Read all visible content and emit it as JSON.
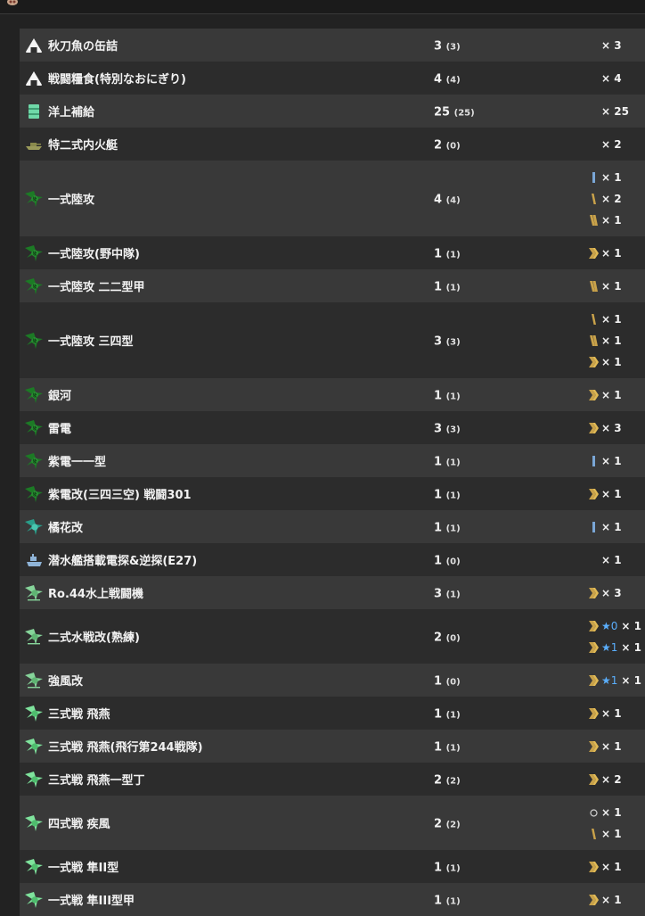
{
  "rows": [
    {
      "icon": "rice-ball-icon",
      "name": "秋刀魚の缶詰",
      "count": "3",
      "sub": "(3)",
      "h": 37,
      "rewards": [
        {
          "prefix": "none",
          "text": "× 3"
        }
      ]
    },
    {
      "icon": "rice-ball-icon",
      "name": "戦闘糧食(特別なおにぎり)",
      "count": "4",
      "sub": "(4)",
      "h": 37,
      "rewards": [
        {
          "prefix": "none",
          "text": "× 4"
        }
      ]
    },
    {
      "icon": "supply-crate-icon",
      "name": "洋上補給",
      "count": "25",
      "sub": "(25)",
      "h": 37,
      "rewards": [
        {
          "prefix": "none",
          "text": "× 25"
        }
      ]
    },
    {
      "icon": "boat-icon",
      "name": "特二式内火艇",
      "count": "2",
      "sub": "(0)",
      "h": 37,
      "rewards": [
        {
          "prefix": "none",
          "text": "× 2"
        }
      ]
    },
    {
      "icon": "land-bomber-icon",
      "name": "一式陸攻",
      "count": "4",
      "sub": "(4)",
      "h": 85,
      "rewards": [
        {
          "prefix": "rank-bar-blue-icon",
          "text": "× 1"
        },
        {
          "prefix": "rank-slash-1-icon",
          "text": "× 2"
        },
        {
          "prefix": "rank-slash-2-icon",
          "text": "× 1"
        }
      ]
    },
    {
      "icon": "land-bomber-icon",
      "name": "一式陸攻(野中隊)",
      "count": "1",
      "sub": "(1)",
      "h": 37,
      "rewards": [
        {
          "prefix": "rank-chevron-icon",
          "text": "× 1"
        }
      ]
    },
    {
      "icon": "land-bomber-icon",
      "name": "一式陸攻 二二型甲",
      "count": "1",
      "sub": "(1)",
      "h": 37,
      "rewards": [
        {
          "prefix": "rank-slash-2-icon",
          "text": "× 1"
        }
      ]
    },
    {
      "icon": "land-bomber-icon",
      "name": "一式陸攻 三四型",
      "count": "3",
      "sub": "(3)",
      "h": 85,
      "rewards": [
        {
          "prefix": "rank-slash-1-icon",
          "text": "× 1"
        },
        {
          "prefix": "rank-slash-2-icon",
          "text": "× 1"
        },
        {
          "prefix": "rank-chevron-icon",
          "text": "× 1"
        }
      ]
    },
    {
      "icon": "land-bomber-icon",
      "name": "銀河",
      "count": "1",
      "sub": "(1)",
      "h": 37,
      "rewards": [
        {
          "prefix": "rank-chevron-icon",
          "text": "× 1"
        }
      ]
    },
    {
      "icon": "land-bomber-icon",
      "name": "雷電",
      "count": "3",
      "sub": "(3)",
      "h": 37,
      "rewards": [
        {
          "prefix": "rank-chevron-icon",
          "text": "× 3"
        }
      ]
    },
    {
      "icon": "land-bomber-icon",
      "name": "紫電一一型",
      "count": "1",
      "sub": "(1)",
      "h": 37,
      "rewards": [
        {
          "prefix": "rank-bar-blue-icon",
          "text": "× 1"
        }
      ]
    },
    {
      "icon": "land-bomber-icon",
      "name": "紫電改(三四三空) 戦闘301",
      "count": "1",
      "sub": "(1)",
      "h": 37,
      "rewards": [
        {
          "prefix": "rank-chevron-icon",
          "text": "× 1"
        }
      ]
    },
    {
      "icon": "teal-plane-icon",
      "name": "橘花改",
      "count": "1",
      "sub": "(1)",
      "h": 37,
      "rewards": [
        {
          "prefix": "rank-bar-blue-icon",
          "text": "× 1"
        }
      ]
    },
    {
      "icon": "submarine-seaplane-icon",
      "name": "潜水艦搭載電探&逆探(E27)",
      "count": "1",
      "sub": "(0)",
      "h": 37,
      "rewards": [
        {
          "prefix": "none",
          "text": "× 1"
        }
      ]
    },
    {
      "icon": "seaplane-fighter-icon",
      "name": "Ro.44水上戦闘機",
      "count": "3",
      "sub": "(1)",
      "h": 37,
      "rewards": [
        {
          "prefix": "rank-chevron-icon",
          "text": "× 3"
        }
      ]
    },
    {
      "icon": "seaplane-fighter-icon",
      "name": "二式水戦改(熟練)",
      "count": "2",
      "sub": "(0)",
      "h": 61,
      "rewards": [
        {
          "prefix": "rank-chevron-icon",
          "star": "★0",
          "text": "× 1"
        },
        {
          "prefix": "rank-chevron-icon",
          "star": "★1",
          "text": "× 1"
        }
      ]
    },
    {
      "icon": "seaplane-fighter-icon",
      "name": "強風改",
      "count": "1",
      "sub": "(0)",
      "h": 37,
      "rewards": [
        {
          "prefix": "rank-chevron-icon",
          "star": "★1",
          "text": "× 1"
        }
      ]
    },
    {
      "icon": "fighter-icon",
      "name": "三式戦 飛燕",
      "count": "1",
      "sub": "(1)",
      "h": 37,
      "rewards": [
        {
          "prefix": "rank-chevron-icon",
          "text": "× 1"
        }
      ]
    },
    {
      "icon": "fighter-icon",
      "name": "三式戦 飛燕(飛行第244戦隊)",
      "count": "1",
      "sub": "(1)",
      "h": 37,
      "rewards": [
        {
          "prefix": "rank-chevron-icon",
          "text": "× 1"
        }
      ]
    },
    {
      "icon": "fighter-icon",
      "name": "三式戦 飛燕一型丁",
      "count": "2",
      "sub": "(2)",
      "h": 37,
      "rewards": [
        {
          "prefix": "rank-chevron-icon",
          "text": "× 2"
        }
      ]
    },
    {
      "icon": "fighter-icon",
      "name": "四式戦 疾風",
      "count": "2",
      "sub": "(2)",
      "h": 61,
      "rewards": [
        {
          "prefix": "circle-icon",
          "text": "× 1"
        },
        {
          "prefix": "rank-slash-1-icon",
          "text": "× 1"
        }
      ]
    },
    {
      "icon": "fighter-icon",
      "name": "一式戦 隼II型",
      "count": "1",
      "sub": "(1)",
      "h": 37,
      "rewards": [
        {
          "prefix": "rank-chevron-icon",
          "text": "× 1"
        }
      ]
    },
    {
      "icon": "fighter-icon",
      "name": "一式戦 隼III型甲",
      "count": "1",
      "sub": "(1)",
      "h": 37,
      "rewards": [
        {
          "prefix": "rank-chevron-icon",
          "text": "× 1"
        }
      ]
    }
  ]
}
